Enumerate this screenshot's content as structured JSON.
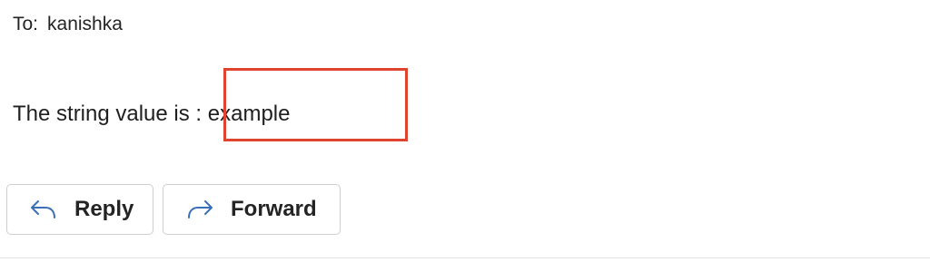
{
  "message": {
    "to_label": "To:",
    "recipient": "kanishka",
    "body_prefix": "The string value is :",
    "body_value": "example"
  },
  "actions": {
    "reply_label": "Reply",
    "reply_icon": "reply-arrow-icon",
    "forward_label": "Forward",
    "forward_icon": "forward-arrow-icon"
  },
  "colors": {
    "highlight_border": "#e0442f",
    "icon_blue": "#3a6fb8",
    "text": "#242424",
    "button_border": "#cfcfcf"
  }
}
